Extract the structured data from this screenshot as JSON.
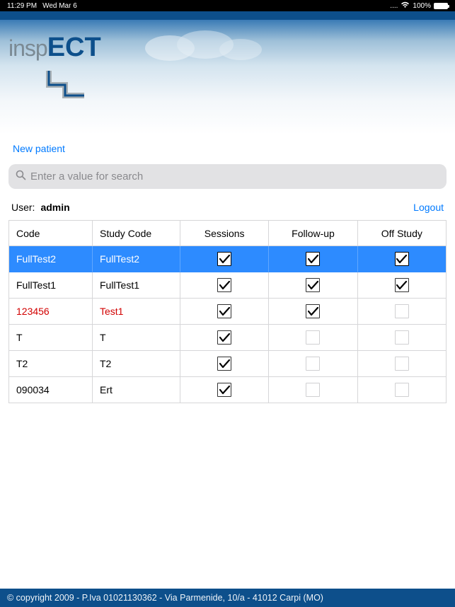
{
  "status": {
    "time": "11:29 PM",
    "date": "Wed Mar 6",
    "battery": "100%"
  },
  "logo": {
    "part1": "insp",
    "part2": "ECT"
  },
  "actions": {
    "new_patient": "New patient",
    "logout": "Logout"
  },
  "search": {
    "placeholder": "Enter a value for search"
  },
  "user": {
    "label": "User:",
    "name": "admin"
  },
  "table": {
    "headers": {
      "code": "Code",
      "study": "Study Code",
      "sessions": "Sessions",
      "followup": "Follow-up",
      "offstudy": "Off Study"
    },
    "rows": [
      {
        "code": "FullTest2",
        "study": "FullTest2",
        "sessions": true,
        "followup": true,
        "offstudy": true,
        "selected": true,
        "red": false
      },
      {
        "code": "FullTest1",
        "study": "FullTest1",
        "sessions": true,
        "followup": true,
        "offstudy": true,
        "selected": false,
        "red": false
      },
      {
        "code": "123456",
        "study": "Test1",
        "sessions": true,
        "followup": true,
        "offstudy": false,
        "selected": false,
        "red": true
      },
      {
        "code": "T",
        "study": "T",
        "sessions": true,
        "followup": false,
        "offstudy": false,
        "selected": false,
        "red": false
      },
      {
        "code": "T2",
        "study": "T2",
        "sessions": true,
        "followup": false,
        "offstudy": false,
        "selected": false,
        "red": false
      },
      {
        "code": "090034",
        "study": "Ert",
        "sessions": true,
        "followup": false,
        "offstudy": false,
        "selected": false,
        "red": false
      }
    ]
  },
  "footer": {
    "text": "© copyright 2009 - P.Iva 01021130362 - Via Parmenide, 10/a - 41012 Carpi (MO)"
  }
}
